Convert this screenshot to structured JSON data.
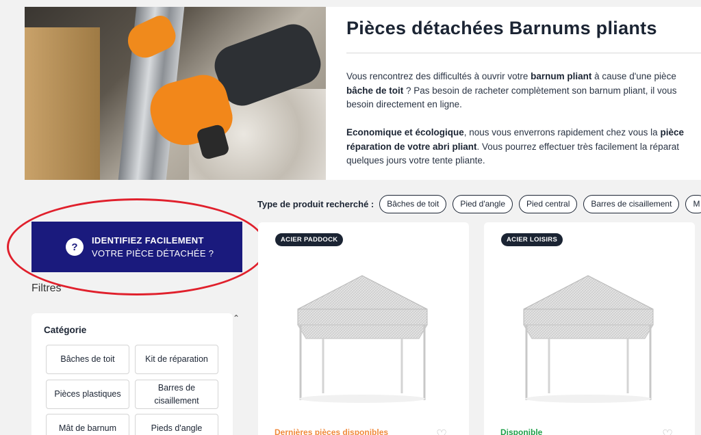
{
  "hero": {
    "title": "Pièces détachées Barnums pliants",
    "p1": {
      "l1a": "Vous rencontrez des difficultés à ouvrir votre ",
      "l1b": "barnum pliant",
      "l1c": " à cause d'une pièce",
      "l2a": "bâche de toit",
      "l2b": " ? Pas besoin de racheter complètement son barnum pliant, il vous",
      "l3": "besoin directement en ligne."
    },
    "p2": {
      "l1a": "Economique et écologique",
      "l1b": ", nous vous enverrons rapidement chez vous la ",
      "l1c": "pièce",
      "l2a": "réparation de votre abri pliant",
      "l2b": ". Vous pourrez effectuer très facilement la réparat",
      "l3": "quelques jours votre tente pliante."
    }
  },
  "type_filter": {
    "label": "Type de produit recherché :",
    "chips": [
      "Bâches de toit",
      "Pied d'angle",
      "Pied central",
      "Barres de cisaillement",
      "M"
    ]
  },
  "identify": {
    "line1": "IDENTIFIEZ FACILEMENT",
    "line2": "VOTRE PIÈCE DÉTACHÉE ?",
    "icon": "?"
  },
  "filters": {
    "title": "Filtres",
    "category": {
      "title": "Catégorie",
      "items": [
        "Bâches de toit",
        "Kit de réparation",
        "Pièces plastiques",
        "Barres de cisaillement",
        "Mât de barnum",
        "Pieds d'angle"
      ]
    }
  },
  "products": [
    {
      "badge": "ACIER PADDOCK",
      "stock": "Dernières pièces disponibles",
      "stock_color": "#f08a3c"
    },
    {
      "badge": "ACIER LOISIRS",
      "stock": "Disponible",
      "stock_color": "#1fa04a"
    }
  ],
  "colors": {
    "primary": "#1a1a7d",
    "dark": "#1b2433",
    "highlight": "#e0202c"
  }
}
